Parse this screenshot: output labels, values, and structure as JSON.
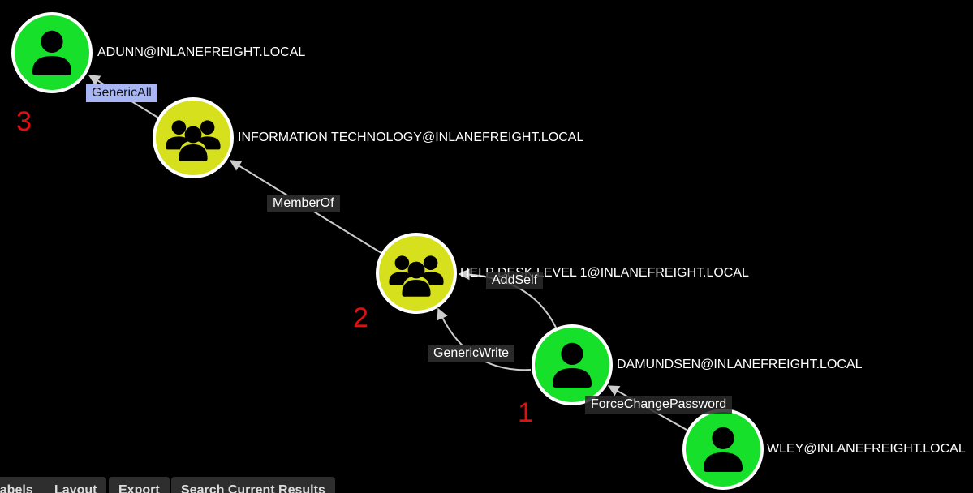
{
  "graph": {
    "nodes": [
      {
        "id": "adunn",
        "label": "ADUNN@INLANEFREIGHT.LOCAL",
        "type": "user",
        "color": "#17e02a"
      },
      {
        "id": "it",
        "label": "INFORMATION TECHNOLOGY@INLANEFREIGHT.LOCAL",
        "type": "group",
        "color": "#d7e01c"
      },
      {
        "id": "helpdesk",
        "label": "HELP DESK LEVEL 1@INLANEFREIGHT.LOCAL",
        "type": "group",
        "color": "#d7e01c"
      },
      {
        "id": "damundsen",
        "label": "DAMUNDSEN@INLANEFREIGHT.LOCAL",
        "type": "user",
        "color": "#17e02a"
      },
      {
        "id": "wley",
        "label": "WLEY@INLANEFREIGHT.LOCAL",
        "type": "user",
        "color": "#17e02a"
      }
    ],
    "edges": [
      {
        "from": "it",
        "to": "adunn",
        "label": "GenericAll",
        "highlight": true
      },
      {
        "from": "helpdesk",
        "to": "it",
        "label": "MemberOf",
        "highlight": false
      },
      {
        "from": "damundsen",
        "to": "helpdesk",
        "label": "AddSelf",
        "highlight": false
      },
      {
        "from": "damundsen",
        "to": "helpdesk",
        "label": "GenericWrite",
        "highlight": false
      },
      {
        "from": "wley",
        "to": "damundsen",
        "label": "ForceChangePassword",
        "highlight": false
      }
    ],
    "step_markers": [
      "1",
      "2",
      "3"
    ]
  },
  "toolbar": {
    "labels_btn": "Labels",
    "layout_btn": "Layout",
    "export_btn": "Export",
    "search_btn": "Search Current Results"
  },
  "colors": {
    "user_node": "#17e02a",
    "group_node": "#d7e01c",
    "node_border": "#ffffff",
    "edge": "#cccccc",
    "step_marker": "#e01010",
    "highlight_label": "#a9b6f5"
  }
}
